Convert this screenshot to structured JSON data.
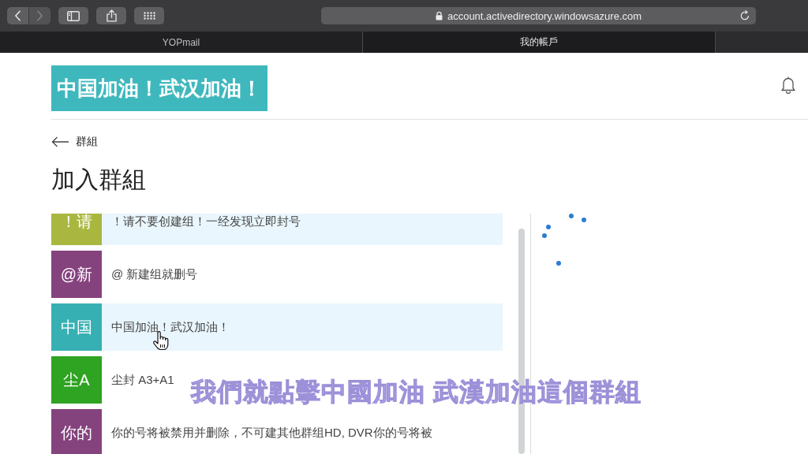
{
  "browser": {
    "toolbar_buttons": [
      {
        "kind": "back",
        "disabled": false
      },
      {
        "kind": "forward",
        "disabled": true
      },
      {
        "kind": "sidebar",
        "disabled": false
      },
      {
        "kind": "share",
        "disabled": false
      },
      {
        "kind": "tabs",
        "disabled": false
      }
    ],
    "address_bar": {
      "value": "account.activedirectory.windowsazure.com",
      "secure": true
    },
    "tabs": [
      {
        "label": "YOPmail",
        "selected": false
      },
      {
        "label": "我的帳戶",
        "selected": true
      }
    ]
  },
  "header": {
    "banner": "中国加油！武汉加油！"
  },
  "breadcrumb": {
    "back_label": "群組"
  },
  "page_title": "加入群組",
  "groups": [
    {
      "badge": "！请",
      "color": "#a9b740",
      "name": "！请不要创建组！一经发现立即封号",
      "highlighted": true,
      "hovered": false
    },
    {
      "badge": "@新",
      "color": "#85437e",
      "name": "@ 新建组就删号",
      "highlighted": false,
      "hovered": false
    },
    {
      "badge": "中国",
      "color": "#37b0b3",
      "name": "中国加油！武汉加油！",
      "highlighted": true,
      "hovered": true
    },
    {
      "badge": "尘A",
      "color": "#2fa322",
      "name": "尘封 A3+A1",
      "highlighted": false,
      "hovered": false
    },
    {
      "badge": "你的",
      "color": "#85437e",
      "name": "你的号将被禁用并删除，不可建其他群组HD, DVR你的号将被",
      "highlighted": false,
      "hovered": false
    }
  ],
  "loading": true,
  "subtitle": "我們就點擊中國加油 武漢加油這個群組"
}
